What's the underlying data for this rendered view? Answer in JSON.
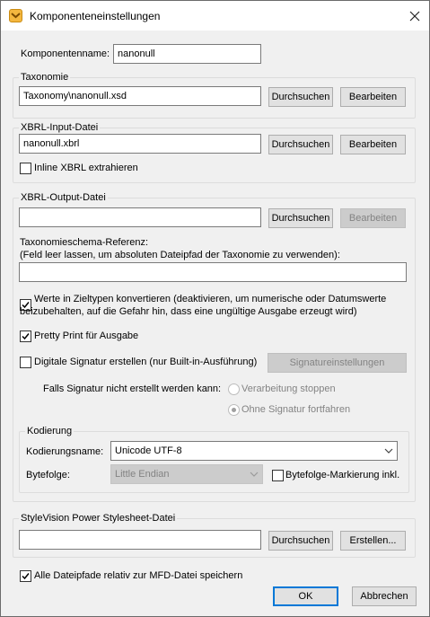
{
  "window": {
    "title": "Komponenteneinstellungen",
    "app_icon": "mapforce-icon",
    "close_icon": "close-icon"
  },
  "component": {
    "label": "Komponentenname:",
    "value": "nanonull"
  },
  "taxonomy": {
    "title": "Taxonomie",
    "value": "Taxonomy\\nanonull.xsd",
    "browse": "Durchsuchen",
    "edit": "Bearbeiten"
  },
  "xbrl_input": {
    "title": "XBRL-Input-Datei",
    "value": "nanonull.xbrl",
    "browse": "Durchsuchen",
    "edit": "Bearbeiten",
    "inline_label": "Inline XBRL extrahieren",
    "inline_checked": false
  },
  "xbrl_output": {
    "title": "XBRL-Output-Datei",
    "value": "",
    "browse": "Durchsuchen",
    "edit": "Bearbeiten",
    "schema_ref_label_1": "Taxonomieschema-Referenz:",
    "schema_ref_label_2": "(Feld leer lassen, um absoluten Dateipfad der Taxonomie zu verwenden):",
    "schema_ref_value": "",
    "convert_label_1": "Werte in Zieltypen konvertieren (deaktivieren, um numerische oder Datumswerte",
    "convert_label_2": "beizubehalten, auf die Gefahr hin, dass eine ungültige Ausgabe erzeugt wird)",
    "convert_checked": true,
    "pretty_label": "Pretty Print für Ausgabe",
    "pretty_checked": true,
    "signature_label": "Digitale Signatur erstellen (nur Built-in-Ausführung)",
    "signature_checked": false,
    "signature_settings": "Signatureinstellungen",
    "fail_label": "Falls Signatur nicht erstellt werden kann:",
    "radio_stop": "Verarbeitung stoppen",
    "radio_continue": "Ohne Signatur fortfahren",
    "encoding": {
      "title": "Kodierung",
      "name_label": "Kodierungsname:",
      "name_value": "Unicode UTF-8",
      "order_label": "Bytefolge:",
      "order_value": "Little Endian",
      "bom_label": "Bytefolge-Markierung inkl.",
      "bom_checked": false
    }
  },
  "stylevision": {
    "title": "StyleVision Power Stylesheet-Datei",
    "value": "",
    "browse": "Durchsuchen",
    "create": "Erstellen..."
  },
  "relative_paths": {
    "label": "Alle Dateipfade relativ zur MFD-Datei speichern",
    "checked": true
  },
  "buttons": {
    "ok": "OK",
    "cancel": "Abbrechen"
  }
}
